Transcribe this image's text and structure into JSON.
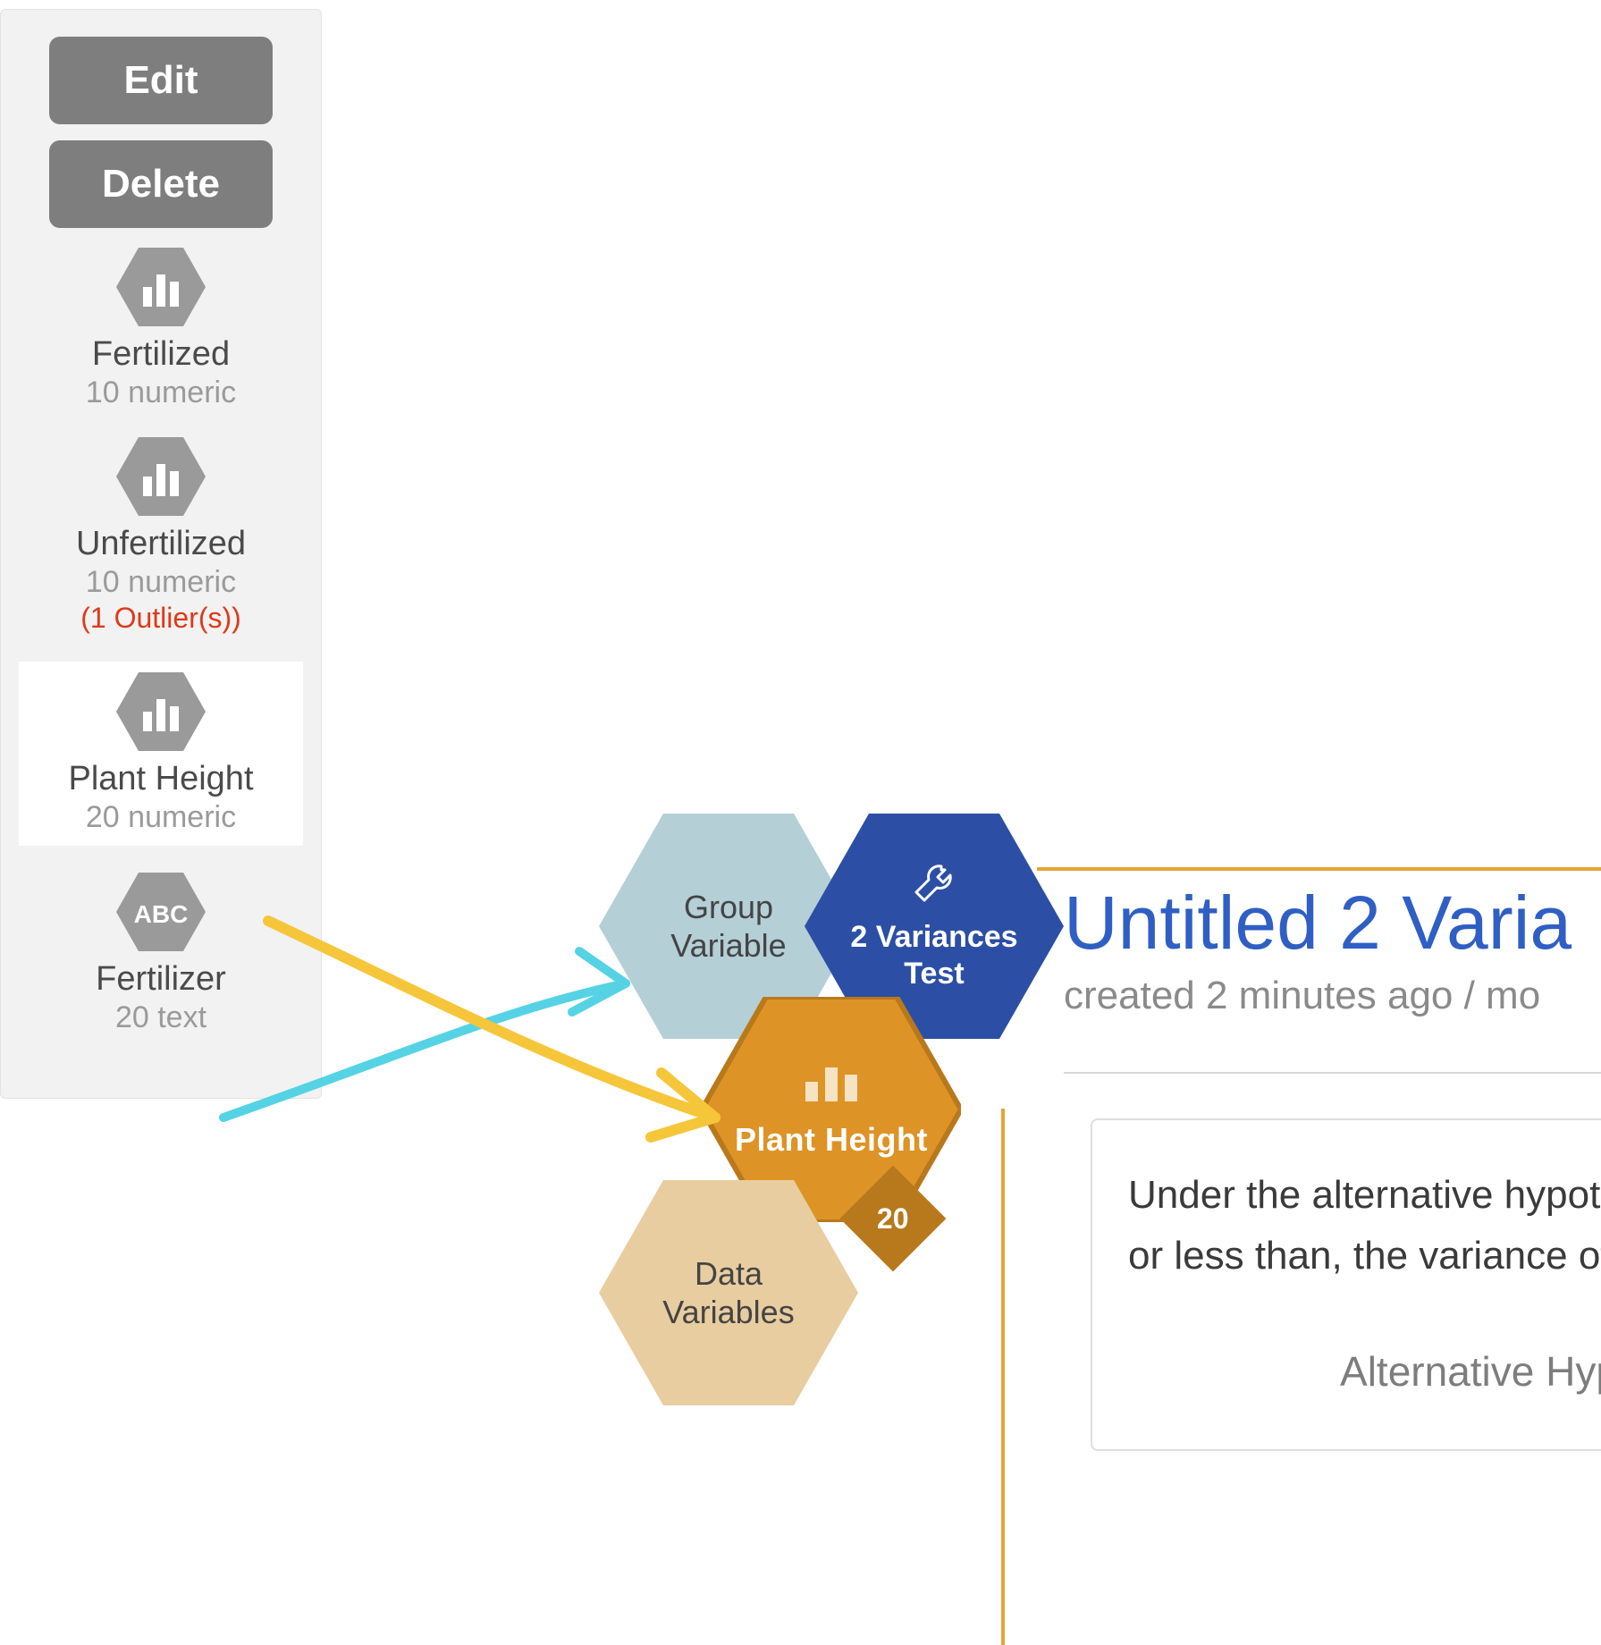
{
  "sidebar": {
    "edit_label": "Edit",
    "delete_label": "Delete",
    "variables": [
      {
        "name": "Fertilized",
        "type": "10 numeric",
        "warn": "",
        "icon": "chart",
        "selected": false
      },
      {
        "name": "Unfertilized",
        "type": "10 numeric",
        "warn": "(1 Outlier(s))",
        "icon": "chart",
        "selected": false
      },
      {
        "name": "Plant Height",
        "type": "20 numeric",
        "warn": "",
        "icon": "chart",
        "selected": true
      },
      {
        "name": "Fertilizer",
        "type": "20 text",
        "warn": "",
        "icon": "abc",
        "selected": false
      }
    ]
  },
  "hexes": {
    "group_variable": {
      "label_l1": "Group",
      "label_l2": "Variable",
      "color": "#b5cfd7"
    },
    "test": {
      "label_l1": "2 Variances",
      "label_l2": "Test",
      "color": "#2c4fa5"
    },
    "plant_height": {
      "label": "Plant Height",
      "badge": "20",
      "color": "#dd9326",
      "stroke": "#b8791c"
    },
    "data_variables": {
      "label_l1": "Data",
      "label_l2": "Variables",
      "color": "#e8cda0"
    }
  },
  "panel": {
    "title": "Untitled 2 Varia",
    "meta": "created 2 minutes ago / mo",
    "body_l1": "Under the alternative hypothes",
    "body_l2": "or less than, the variance of po",
    "subheading": "Alternative Hyp"
  }
}
